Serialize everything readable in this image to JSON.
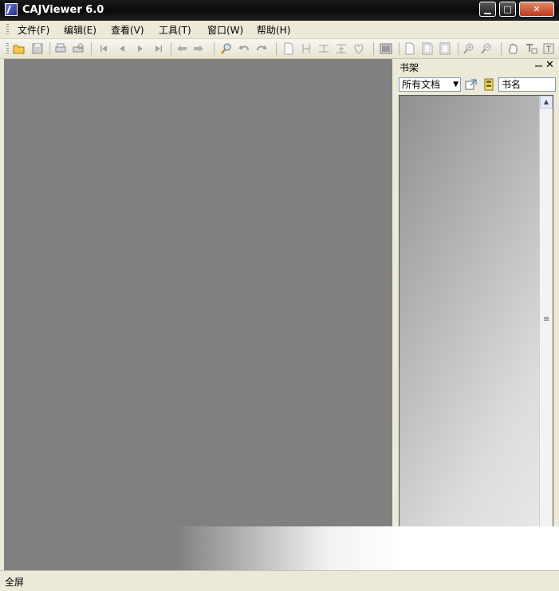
{
  "window": {
    "title": "CAJViewer 6.0",
    "min_glyph": "▁",
    "max_glyph": "□",
    "close_glyph": "✕"
  },
  "menu": {
    "items": [
      "文件(F)",
      "编辑(E)",
      "查看(V)",
      "工具(T)",
      "窗口(W)",
      "帮助(H)"
    ]
  },
  "toolbar": {
    "icons": [
      "open-icon",
      "save-icon",
      "print-icon",
      "print-preview-icon",
      "first-page-icon",
      "prev-page-icon",
      "next-page-icon",
      "last-page-icon",
      "back-icon",
      "forward-icon",
      "find-icon",
      "undo-icon",
      "redo-icon",
      "single-page-icon",
      "fit-width-icon",
      "fit-height-icon",
      "fit-page-icon",
      "continuous-icon",
      "image-icon",
      "page-a-icon",
      "page-b-icon",
      "page-c-icon",
      "zoom-in-icon",
      "zoom-out-icon",
      "hand-icon",
      "text-select-icon",
      "text-box-icon"
    ]
  },
  "panel": {
    "title": "书架",
    "pin_glyph": "ꟷ",
    "close_glyph": "✕",
    "filter_value": "所有文档",
    "search_value": "书名"
  },
  "status": {
    "text": "全屏"
  },
  "colors": {
    "canvas": "#808080",
    "titlebar": "#0a0a0a",
    "chrome": "#ece9d8"
  }
}
